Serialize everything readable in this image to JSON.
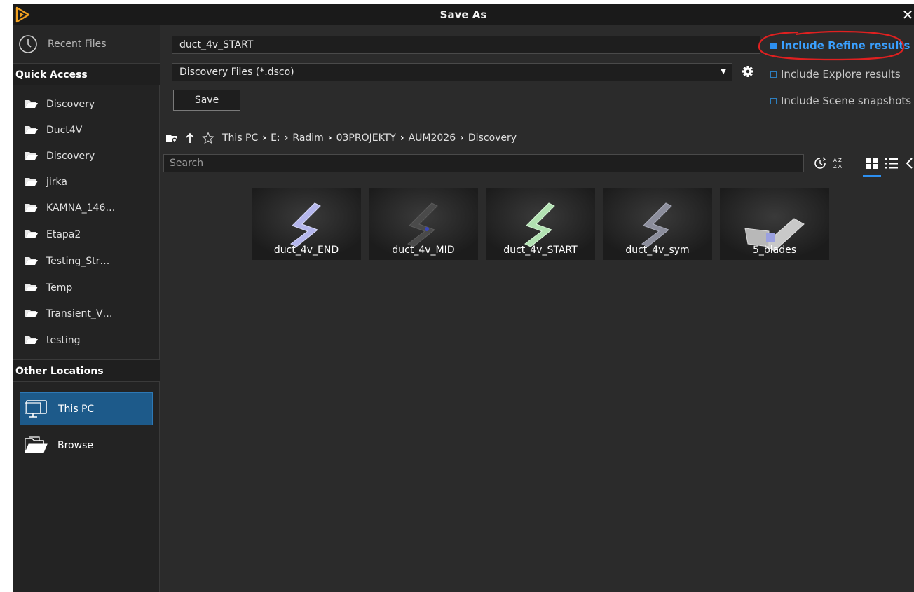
{
  "window": {
    "title": "Save As"
  },
  "sidebar": {
    "recent_label": "Recent Files",
    "quick_access_header": "Quick Access",
    "quick_access": [
      {
        "label": "Discovery"
      },
      {
        "label": "Duct4V"
      },
      {
        "label": "Discovery"
      },
      {
        "label": "jirka"
      },
      {
        "label": "KAMNA_146…"
      },
      {
        "label": "Etapa2"
      },
      {
        "label": "Testing_Str…"
      },
      {
        "label": "Temp"
      },
      {
        "label": "Transient_V…"
      },
      {
        "label": "testing"
      }
    ],
    "other_locations_header": "Other Locations",
    "other_locations": [
      {
        "label": "This PC",
        "icon": "monitor-icon",
        "selected": true
      },
      {
        "label": "Browse",
        "icon": "open-folder-icon",
        "selected": false
      }
    ]
  },
  "form": {
    "filename_value": "duct_4v_START",
    "filetype_value": "Discovery Files (*.dsco)",
    "save_label": "Save",
    "options": [
      {
        "label": "Include Refine results",
        "checked": true
      },
      {
        "label": "Include Explore results",
        "checked": false
      },
      {
        "label": "Include Scene snapshots",
        "checked": false
      }
    ]
  },
  "path": {
    "crumbs": [
      "This PC",
      "E:",
      "Radim",
      "03PROJEKTY",
      "AUM2026",
      "Discovery"
    ]
  },
  "search": {
    "placeholder": "Search",
    "value": ""
  },
  "files": [
    {
      "name": "duct_4v_END",
      "tint": "#b4b6ec"
    },
    {
      "name": "duct_4v_MID",
      "tint": "#4a4a4a"
    },
    {
      "name": "duct_4v_START",
      "tint": "#b2e2b2"
    },
    {
      "name": "duct_4v_sym",
      "tint": "#8c8e9c"
    },
    {
      "name": "5_blades",
      "tint": "#c8c8c8"
    }
  ],
  "colors": {
    "accent": "#2d8ff0",
    "selected_bg": "#1d5a8a",
    "annotation": "#e02020",
    "logo": "#f0a020"
  }
}
